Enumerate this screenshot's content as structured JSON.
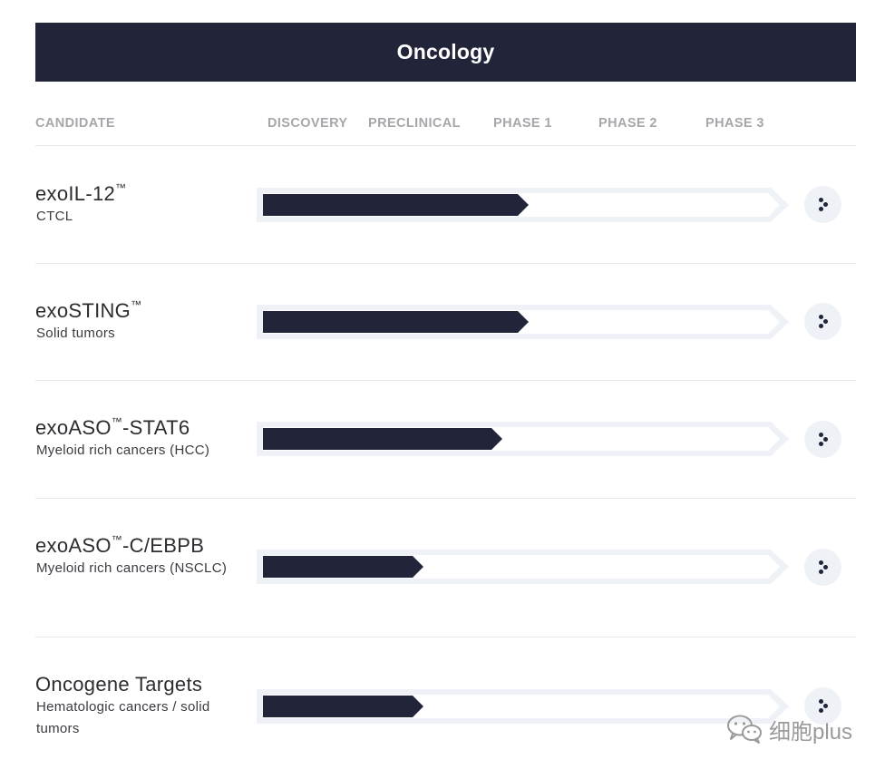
{
  "header": {
    "title": "Oncology"
  },
  "columns": [
    {
      "label": "CANDIDATE"
    },
    {
      "label": "DISCOVERY"
    },
    {
      "label": "PRECLINICAL"
    },
    {
      "label": "PHASE 1"
    },
    {
      "label": "PHASE 2"
    },
    {
      "label": "PHASE 3"
    }
  ],
  "candidates": [
    {
      "name": "exoIL-12",
      "mark": "™",
      "suffix": "",
      "indication": "CTCL",
      "progress_fraction": 0.522
    },
    {
      "name": "exoSTING",
      "mark": "™",
      "suffix": "",
      "indication": "Solid tumors",
      "progress_fraction": 0.522
    },
    {
      "name": "exoASO",
      "mark": "™",
      "suffix": "-STAT6",
      "indication": "Myeloid rich cancers (HCC)",
      "progress_fraction": 0.471
    },
    {
      "name": "exoASO",
      "mark": "™",
      "suffix": "-C/EBPB",
      "indication": "Myeloid rich cancers (NSCLC)",
      "progress_fraction": 0.32
    },
    {
      "name": "Oncogene Targets",
      "mark": "",
      "suffix": "",
      "indication": "Hematologic cancers / solid tumors",
      "progress_fraction": 0.32
    }
  ],
  "colors": {
    "navy": "#22243a",
    "track": "#eef1f6",
    "muted": "#a6a7ab"
  },
  "icons": {
    "row_action": "scatter-dots-icon",
    "watermark": "wechat-icon"
  },
  "watermark": {
    "text": "细胞plus"
  }
}
